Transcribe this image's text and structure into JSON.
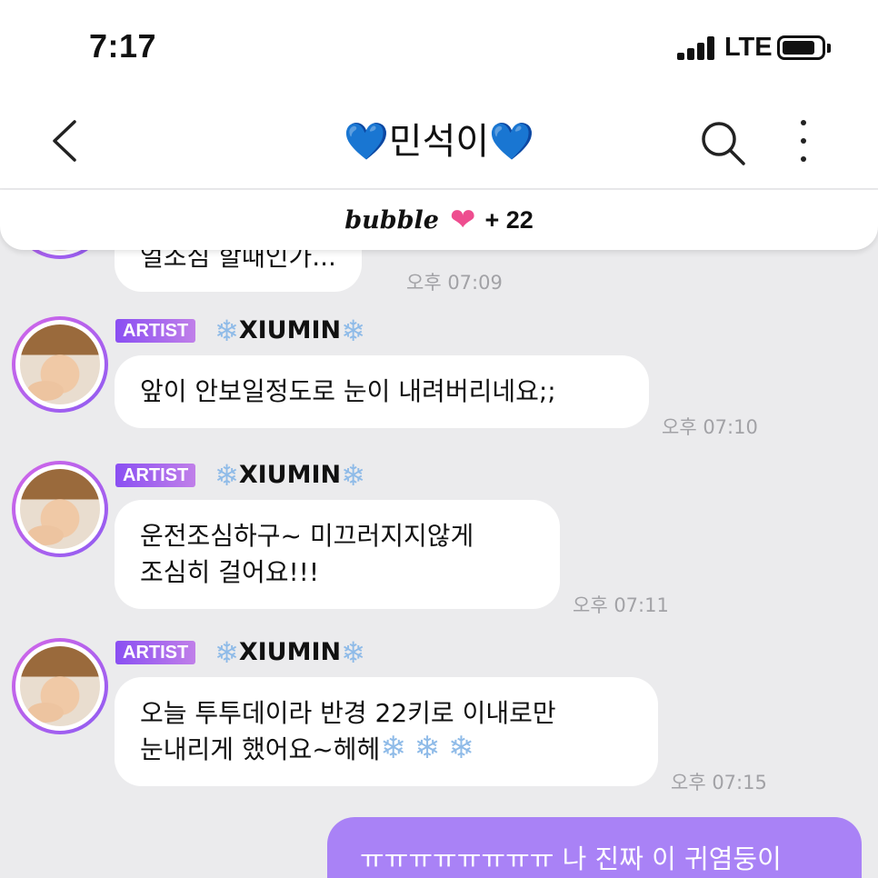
{
  "status_bar": {
    "time": "7:17",
    "network": "LTE",
    "icons": [
      "signal-icon",
      "battery-icon"
    ]
  },
  "header": {
    "title": "민석이",
    "title_heart_glyph": "💙",
    "icons": [
      "back-arrow-icon",
      "search-icon",
      "more-vertical-icon"
    ]
  },
  "banner": {
    "brand": "bubble",
    "heart_glyph": "❤",
    "count": "+ 22",
    "heart_color": "#ee4d8f"
  },
  "messages": [
    {
      "text": "얼조심 할때인가...",
      "time": "오후 07:09"
    },
    {
      "badge": "ARTIST",
      "sender": "XIUMIN",
      "text": "앞이 안보일정도로 눈이 내려버리네요;;",
      "time": "오후 07:10"
    },
    {
      "badge": "ARTIST",
      "sender": "XIUMIN",
      "text_line1": "운전조심하구~ 미끄러지지않게",
      "text_line2": "조심히 걸어요!!!",
      "time": "오후 07:11"
    },
    {
      "badge": "ARTIST",
      "sender": "XIUMIN",
      "text_line1": "오늘 투투데이라 반경 22키로 이내로만",
      "text_line2": "눈내리게 했어요~헤헤",
      "time": "오후 07:15"
    }
  ],
  "my_message": {
    "text": "ㅠㅠㅠㅠㅠㅠㅠㅠ 나 진짜 이 귀염둥이"
  },
  "snowflake_glyph": "❄",
  "colors": {
    "artist_badge": "#9b5cf0",
    "my_bubble": "#a982f6",
    "heart_blue": "#1c73f0",
    "chat_bg": "#ebebed"
  }
}
